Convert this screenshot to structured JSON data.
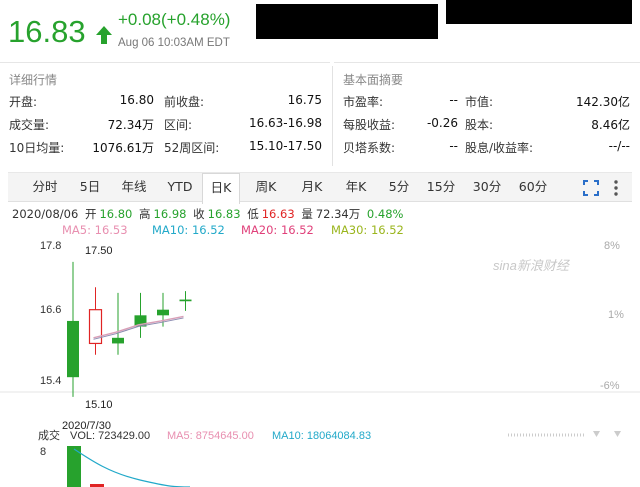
{
  "quote": {
    "price": "16.83",
    "change": "+0.08(+0.48%)",
    "time": "Aug 06 10:03AM EDT",
    "up_color": "#27a22d",
    "down_color": "#e02424"
  },
  "detail": {
    "title": "详细行情",
    "rows": [
      {
        "l1": "开盘:",
        "v1": "16.80",
        "l2": "前收盘:",
        "v2": "16.75"
      },
      {
        "l1": "成交量:",
        "v1": "72.34万",
        "l2": "区间:",
        "v2": "16.63-16.98"
      },
      {
        "l1": "10日均量:",
        "v1": "1076.61万",
        "l2": "52周区间:",
        "v2": "15.10-17.50"
      }
    ]
  },
  "fundamentals": {
    "title": "基本面摘要",
    "rows": [
      {
        "l1": "市盈率:",
        "v1": "--",
        "l2": "市值:",
        "v2": "142.30亿"
      },
      {
        "l1": "每股收益:",
        "v1": "-0.26",
        "l2": "股本:",
        "v2": "8.46亿"
      },
      {
        "l1": "贝塔系数:",
        "v1": "--",
        "l2": "股息/收益率:",
        "v2": "--/--"
      }
    ]
  },
  "tabs": [
    "分时",
    "5日",
    "年线",
    "YTD",
    "日K",
    "周K",
    "月K",
    "年K",
    "5分",
    "15分",
    "30分",
    "60分"
  ],
  "active_tab": "日K",
  "toolbar_icons": [
    "fullscreen-icon",
    "more-vertical-icon"
  ],
  "ohlc": {
    "date": "2020/08/06",
    "open_label": "开",
    "open": "16.80",
    "high_label": "高",
    "high": "16.98",
    "close_label": "收",
    "close": "16.83",
    "low_label": "低",
    "low": "16.63",
    "vol_label": "量",
    "vol": "72.34万",
    "pct": "0.48%"
  },
  "ma": {
    "ma5": "MA5: 16.53",
    "ma5_color": "#e88fb0",
    "ma10": "MA10: 16.52",
    "ma10_color": "#22a9c9",
    "ma20": "MA20: 16.52",
    "ma20_color": "#e0407a",
    "ma30": "MA30: 16.52",
    "ma30_color": "#9ab51c"
  },
  "watermark": "sina新浪财经",
  "volume_bar": {
    "label": "成交",
    "vol": "VOL: 723429.00",
    "ma5": "MA5: 8754645.00",
    "ma10": "MA10: 18064084.83"
  },
  "chart_data": {
    "type": "candlestick",
    "y_ticks": [
      "17.8",
      "16.6",
      "15.4"
    ],
    "pct_ticks": [
      "8%",
      "1%",
      "-6%"
    ],
    "high_label": "17.50",
    "low_label": "15.10",
    "date_label": "2020/7/30",
    "ylim": [
      15.4,
      17.8
    ],
    "candles": [
      {
        "open": 16.45,
        "close": 15.45,
        "high": 17.5,
        "low": 15.1
      },
      {
        "open": 16.05,
        "close": 16.65,
        "high": 17.05,
        "low": 15.85
      },
      {
        "open": 16.15,
        "close": 16.05,
        "high": 16.95,
        "low": 15.85
      },
      {
        "open": 16.35,
        "close": 16.55,
        "high": 16.95,
        "low": 16.15
      },
      {
        "open": 16.55,
        "close": 16.65,
        "high": 16.95,
        "low": 16.35
      },
      {
        "open": 16.8,
        "close": 16.83,
        "high": 16.98,
        "low": 16.63
      }
    ],
    "ma_line": [
      16.15,
      16.25,
      16.38,
      16.45,
      16.53
    ],
    "volume_axis_tick": "8"
  }
}
